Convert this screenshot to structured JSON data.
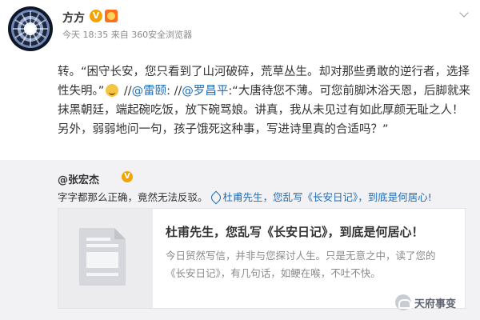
{
  "post": {
    "username": "方方",
    "verified_badge": "V",
    "meta": "今天 18:35 来自 360安全浏览器",
    "text": {
      "prefix": "转。“困守长安，您只看到了山河破碎，荒草丛生。却对那些勇敢的逆行者，选择性失明。”",
      "sep1": " //",
      "mention1": "@雷颐",
      "sep2": ": //",
      "mention2": "@罗昌平",
      "rest": ":“大唐待您不薄。可您前脚沐浴天恩，后脚就来抹黑朝廷，端起碗吃饭，放下碗骂娘。讲真，我从未见过有如此厚颜无耻之人！另外，弱弱地问一句，孩子饿死这种事，写进诗里真的合适吗？”"
    }
  },
  "repost": {
    "username": "@张宏杰",
    "verified_badge": "V",
    "text": "字字都那么正确，竟然无法反驳。",
    "link_text": "杜甫先生，您乱写《长安日记》，到底是何居心!"
  },
  "card": {
    "title": "杜甫先生，您乱写《长安日记》，到底是何居心！",
    "desc": "今日贸然写信，并非与您探讨人生。只是无意之中，读了您的《长安日记》，有几句话，如鲠在喉，不吐不快。"
  },
  "watermark": {
    "text": "天府事变"
  },
  "icons": {
    "avatar": "avatar-image",
    "verified": "verified-v-icon",
    "fan": "fan-badge-icon",
    "menu": "chevron-down-icon",
    "emoji": "grin-emoji-icon",
    "link": "link-icon",
    "doc": "document-thumbnail-icon"
  },
  "colors": {
    "link": "#1f6cb5",
    "verified": "#f3a400",
    "repost_bg": "#f2f2f5"
  }
}
